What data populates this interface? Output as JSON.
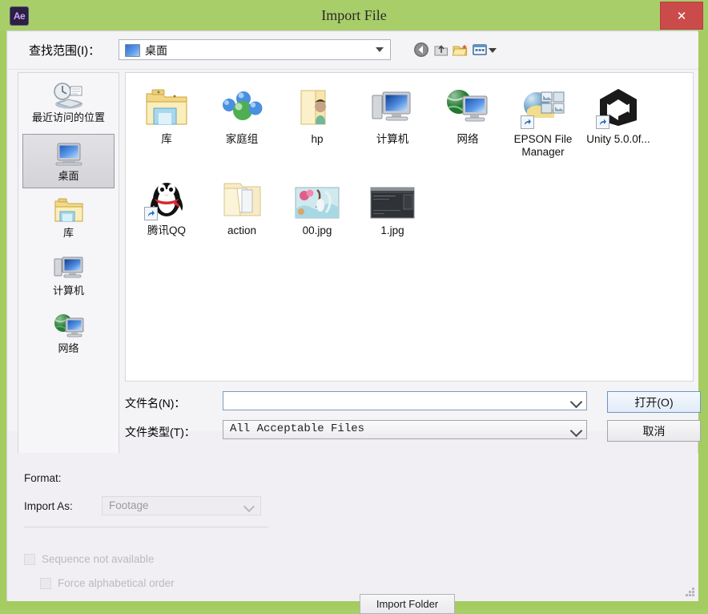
{
  "window": {
    "title": "Import File",
    "app_icon_label": "Ae",
    "close_label": "✕",
    "titlebar_color": "#a8ce6a",
    "close_color": "#cb4a4a"
  },
  "lookin": {
    "label": "查找范围(I)：",
    "value": "桌面",
    "icon": "desktop-icon"
  },
  "toolbar": {
    "buttons": [
      {
        "name": "back-button",
        "icon": "back-arrow-icon",
        "label": "Back"
      },
      {
        "name": "up-one-level-button",
        "icon": "up-folder-icon",
        "label": "Up One Level"
      },
      {
        "name": "new-folder-button",
        "icon": "new-folder-icon",
        "label": "Create New Folder"
      },
      {
        "name": "views-button",
        "icon": "views-grid-icon",
        "label": "Views"
      }
    ]
  },
  "places": {
    "items": [
      {
        "label": "最近访问的位置",
        "icon": "recent-places-icon",
        "selected": false
      },
      {
        "label": "桌面",
        "icon": "desktop-icon",
        "selected": true
      },
      {
        "label": "库",
        "icon": "libraries-icon",
        "selected": false
      },
      {
        "label": "计算机",
        "icon": "computer-icon",
        "selected": false
      },
      {
        "label": "网络",
        "icon": "network-icon",
        "selected": false
      }
    ]
  },
  "filelist": {
    "items": [
      {
        "label": "库",
        "icon": "libraries-folder-icon",
        "shortcut": false
      },
      {
        "label": "家庭组",
        "icon": "homegroup-icon",
        "shortcut": false
      },
      {
        "label": "hp",
        "icon": "user-folder-icon",
        "shortcut": false
      },
      {
        "label": "计算机",
        "icon": "computer-icon",
        "shortcut": false
      },
      {
        "label": "网络",
        "icon": "network-icon",
        "shortcut": false
      },
      {
        "label": "EPSON File Manager",
        "icon": "epson-file-manager-icon",
        "shortcut": true
      },
      {
        "label": "Unity 5.0.0f...",
        "icon": "unity-icon",
        "shortcut": true
      },
      {
        "label": "腾讯QQ",
        "icon": "qq-penguin-icon",
        "shortcut": true
      },
      {
        "label": "action",
        "icon": "folder-icon",
        "shortcut": false
      },
      {
        "label": "00.jpg",
        "icon": "image-thumbnail-icon",
        "shortcut": false
      },
      {
        "label": "1.jpg",
        "icon": "dark-screenshot-thumbnail-icon",
        "shortcut": false
      }
    ]
  },
  "form": {
    "filename_label": "文件名(N)：",
    "filename_value": "",
    "filename_placeholder": "",
    "filetype_label": "文件类型(T)：",
    "filetype_value": "All Acceptable Files",
    "open_button": "打开(O)",
    "cancel_button": "取消"
  },
  "options": {
    "format_label": "Format:",
    "format_value": "",
    "import_as_label": "Import As:",
    "import_as_value": "Footage",
    "sequence_label": "Sequence not available",
    "sequence_checked": false,
    "force_alpha_label": "Force alphabetical order",
    "force_alpha_checked": false,
    "import_folder_button": "Import Folder"
  }
}
